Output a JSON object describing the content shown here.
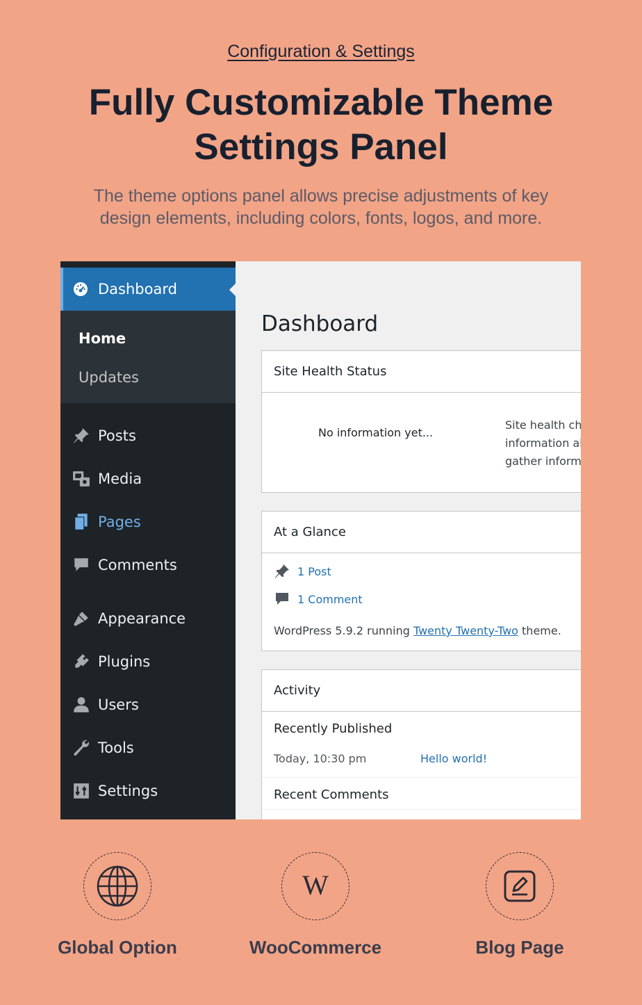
{
  "header": {
    "eyebrow": "Configuration & Settings",
    "title_line1": "Fully Customizable Theme",
    "title_line2": "Settings Panel",
    "subtitle_line1": "The theme options panel allows precise adjustments of key",
    "subtitle_line2": "design elements, including colors, fonts, logos, and more."
  },
  "sidebar": {
    "active": "Dashboard",
    "submenu": [
      "Home",
      "Updates"
    ],
    "items": [
      {
        "label": "Posts",
        "icon": "pin-icon"
      },
      {
        "label": "Media",
        "icon": "media-icon"
      },
      {
        "label": "Pages",
        "icon": "pages-icon"
      },
      {
        "label": "Comments",
        "icon": "comment-icon"
      },
      {
        "label": "Appearance",
        "icon": "brush-icon"
      },
      {
        "label": "Plugins",
        "icon": "plugin-icon"
      },
      {
        "label": "Users",
        "icon": "user-icon"
      },
      {
        "label": "Tools",
        "icon": "wrench-icon"
      },
      {
        "label": "Settings",
        "icon": "settings-icon"
      }
    ]
  },
  "main": {
    "title": "Dashboard",
    "site_health": {
      "heading": "Site Health Status",
      "empty": "No information yet...",
      "desc_line1": "Site health che",
      "desc_line2": "information ab",
      "desc_line3": "gather informa"
    },
    "glance": {
      "heading": "At a Glance",
      "posts": "1 Post",
      "comments": "1 Comment",
      "running_prefix": "WordPress 5.9.2 running ",
      "theme": "Twenty Twenty-Two",
      "running_suffix": " theme."
    },
    "activity": {
      "heading": "Activity",
      "recently_published": "Recently Published",
      "date": "Today, 10:30 pm",
      "post_link": "Hello world!",
      "recent_comments": "Recent Comments"
    }
  },
  "features": [
    {
      "label": "Global Option",
      "icon": "globe-icon"
    },
    {
      "label": "WooCommerce",
      "icon": "wordpress-icon"
    },
    {
      "label": "Blog Page",
      "icon": "edit-icon"
    }
  ],
  "colors": {
    "background": "#f2a487",
    "sidebar": "#1d2327",
    "accent": "#2271b1",
    "active_text": "#72aee6"
  }
}
